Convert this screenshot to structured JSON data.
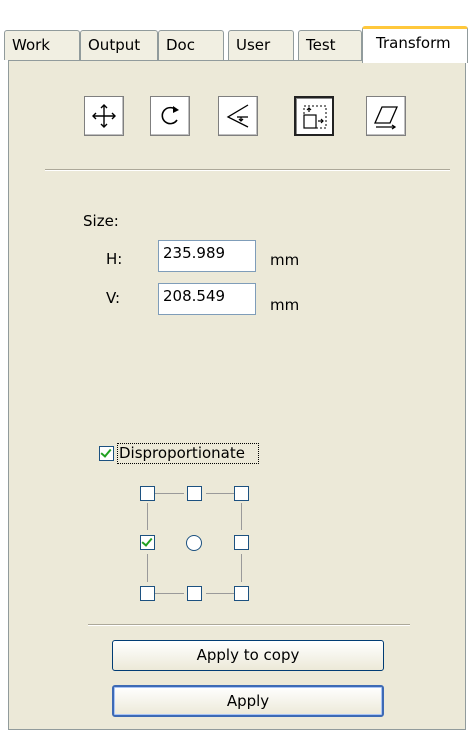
{
  "tabs": [
    {
      "label": "Work",
      "active": false
    },
    {
      "label": "Output",
      "active": false
    },
    {
      "label": "Doc",
      "active": false
    },
    {
      "label": "User",
      "active": false
    },
    {
      "label": "Test",
      "active": false
    },
    {
      "label": "Transform",
      "active": true
    }
  ],
  "toolbar": {
    "tools": [
      {
        "icon": "move-icon",
        "active": false
      },
      {
        "icon": "rotate-icon",
        "active": false
      },
      {
        "icon": "mirror-icon",
        "active": false
      },
      {
        "icon": "scale-icon",
        "active": true
      },
      {
        "icon": "skew-icon",
        "active": false
      }
    ]
  },
  "size": {
    "label": "Size:",
    "h_label": "H:",
    "h_value": "235.989",
    "v_label": "V:",
    "v_value": "208.549",
    "unit": "mm"
  },
  "disproportionate": {
    "label": "Disproportionate",
    "checked": true
  },
  "anchor_grid": {
    "checked_position": "middle-left",
    "center": "radio"
  },
  "buttons": {
    "apply_to_copy": "Apply to copy",
    "apply": "Apply"
  },
  "colors": {
    "panel_bg": "#ece9d8",
    "active_tab_accent": "#ffc83c",
    "check_green": "#21a121",
    "default_button_border": "#3d6ab5"
  }
}
